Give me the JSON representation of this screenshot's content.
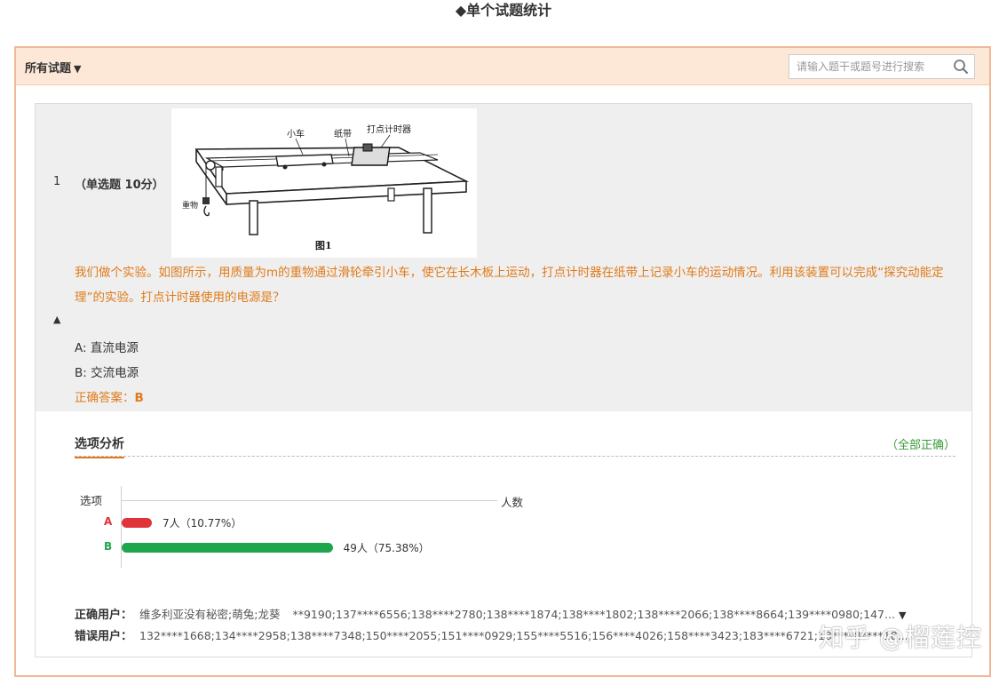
{
  "page": {
    "title": "◆单个试题统计"
  },
  "header": {
    "filter_label": "所有试题",
    "search_placeholder": "请输入题干或题号进行搜索",
    "icons": {
      "search": "search-icon",
      "caret": "caret-down-icon"
    }
  },
  "question": {
    "number": "1",
    "type_label": "（单选题 10分）",
    "figure_labels": {
      "cart": "小车",
      "tape": "纸带",
      "timer": "打点计时器",
      "weight": "重物",
      "caption": "图1"
    },
    "text": "我们做个实验。如图所示，用质量为m的重物通过滑轮牵引小车，使它在长木板上运动，打点计时器在纸带上记录小车的运动情况。利用该装置可以完成“探究动能定理”的实验。打点计时器使用的电源是？",
    "collapse_icon": "▲",
    "options": [
      {
        "key": "A:",
        "text": "直流电源"
      },
      {
        "key": "B:",
        "text": "交流电源"
      }
    ],
    "answer_label": "正确答案：",
    "answer_value": "B"
  },
  "analysis": {
    "title": "选项分析",
    "status": "（全部正确）",
    "axis_category_label": "选项",
    "axis_value_label": "人数"
  },
  "chart_data": {
    "type": "bar",
    "orientation": "horizontal",
    "categories": [
      "A",
      "B"
    ],
    "values": [
      7,
      49
    ],
    "labels": [
      "7人（10.77%）",
      "49人（75.38%）"
    ],
    "percent": [
      10.77,
      75.38
    ],
    "colors": [
      "#e0333a",
      "#1ea64b"
    ],
    "xlabel": "人数",
    "ylabel": "选项"
  },
  "users": {
    "correct_label": "正确用户：",
    "correct_names": "维多利亚没有秘密;萌兔;龙葵",
    "correct_ids": "**9190;137****6556;138****2780;138****1874;138****1802;138****2066;138****8664;139****0980;147...",
    "wrong_label": "错误用户：",
    "wrong_ids": "132****1668;134****2958;138****7348;150****2055;151****0929;155****5516;156****4026;158****3423;183****6721;18****8****18...",
    "more_icon": "▼"
  },
  "watermark": "知乎 @榴莲控"
}
